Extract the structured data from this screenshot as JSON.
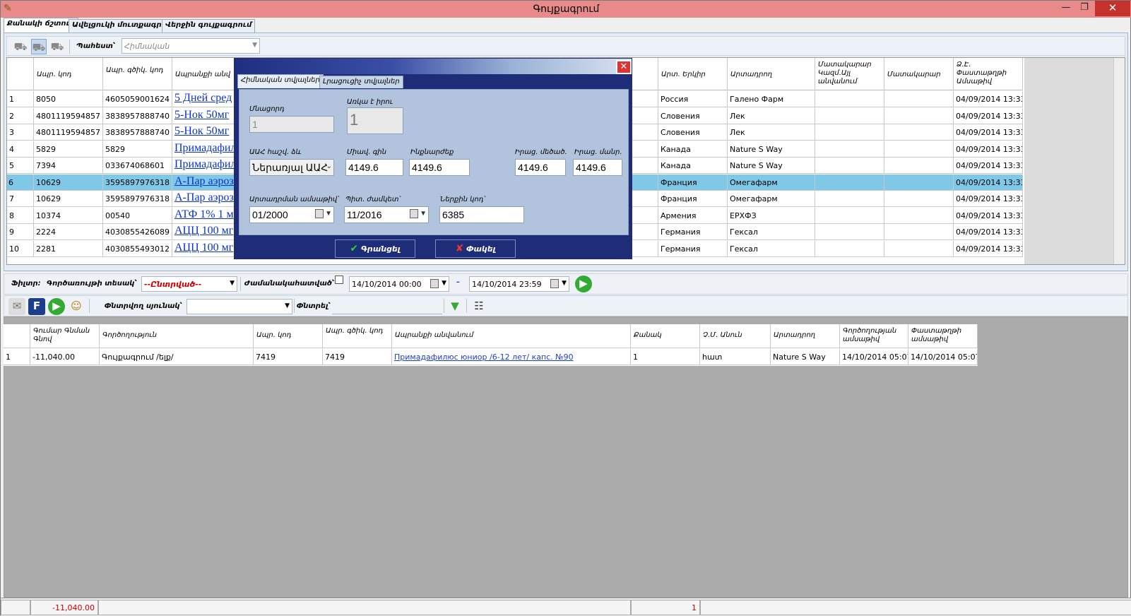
{
  "window": {
    "title": "Գույքագրում",
    "minimize": "—",
    "maximize": "❐",
    "close": "✕",
    "app_icon": "notebook-icon"
  },
  "tabs": [
    "Քանակի ճշտում",
    "Ավելցուկի մուտքագրում",
    "Վերջին գույքագրում"
  ],
  "toolbar1": {
    "warehouse_label": "Պահեստ՝",
    "warehouse_value": "Հիմնական"
  },
  "main_grid": {
    "headers": [
      "Ապր. կոդ",
      "Ապր. գծիկ. կոդ",
      "Ապրանքի անվ",
      "Արտ. Երկիր",
      "Արտադրող",
      "Մատակարար Կազմ.Այլ անվանում",
      "Մատակարար",
      "Ձ.Է. Փաստաթղթի Ամսաթիվ"
    ],
    "rows": [
      {
        "n": "1",
        "code": "8050",
        "barcode": "4605059001624",
        "name": "5 Дней сред",
        "country": "Россия",
        "maker": "Галено Фарм",
        "date": "04/09/2014 13:33"
      },
      {
        "n": "2",
        "code": "4801119594857",
        "barcode": "3838957888740",
        "name": "5-Нок 50мг",
        "country": "Словения",
        "maker": "Лек",
        "date": "04/09/2014 13:33"
      },
      {
        "n": "3",
        "code": "4801119594857",
        "barcode": "3838957888740",
        "name": "5-Нок 50мг",
        "country": "Словения",
        "maker": "Лек",
        "date": "04/09/2014 13:33"
      },
      {
        "n": "4",
        "code": "5829",
        "barcode": "5829",
        "name": "Примадафил",
        "country": "Канада",
        "maker": "Nature S Way",
        "date": "04/09/2014 13:33"
      },
      {
        "n": "5",
        "code": "7394",
        "barcode": "033674068601",
        "name": "Примадафил",
        "country": "Канада",
        "maker": "Nature S Way",
        "date": "04/09/2014 13:33"
      },
      {
        "n": "6",
        "code": "10629",
        "barcode": "3595897976318",
        "name": "А-Пар аэроз",
        "country": "Франция",
        "maker": "Омегафарм",
        "date": "04/09/2014 13:33"
      },
      {
        "n": "7",
        "code": "10629",
        "barcode": "3595897976318",
        "name": "А-Пар аэроз",
        "country": "Франция",
        "maker": "Омегафарм",
        "date": "04/09/2014 13:33"
      },
      {
        "n": "8",
        "code": "10374",
        "barcode": "00540",
        "name": "АТФ 1% 1 м",
        "country": "Армения",
        "maker": "ЕРХФЗ",
        "date": "04/09/2014 13:33"
      },
      {
        "n": "9",
        "code": "2224",
        "barcode": "4030855426089",
        "name": "АЦЦ 100 мг",
        "country": "Германия",
        "maker": "Гексал",
        "date": "04/09/2014 13:33"
      },
      {
        "n": "10",
        "code": "2281",
        "barcode": "4030855493012",
        "name": "АЦЦ 100 мг",
        "country": "Германия",
        "maker": "Гексал",
        "date": "04/09/2014 13:33"
      }
    ]
  },
  "dialog": {
    "tab_main": "Հիմնական տվյալներ",
    "tab_extra": "Լրացուցիչ տվյալներ",
    "remainder_label": "Մնացորդ",
    "remainder_value": "1",
    "actual_label": "Առկա է իրու",
    "actual_value": "1",
    "vat_label": "ԱԱՀ հաշվ. ձև",
    "vat_value": "Ներառյալ ԱԱՀ",
    "unit_price_label": "Միավ. գին",
    "unit_price_value": "4149.6",
    "cost_label": "Ինքնարժեք",
    "cost_value": "4149.6",
    "wholesale_label": "Իրաց. մեծած.",
    "wholesale_value": "4149.6",
    "retail_label": "Իրաց. մանր.",
    "retail_value": "4149.6",
    "prod_date_label": "Արտադրման ամսաթիվ՝",
    "prod_date_value": "01/2000",
    "expiry_label": "Պիտ. ժամկետ՝",
    "expiry_value": "11/2016",
    "internal_code_label": "Ներքին կոդ՝",
    "internal_code_value": "6385",
    "ok_label": "Գրանցել",
    "cancel_label": "Փակել"
  },
  "filter": {
    "label": "Ֆիլտր:",
    "op_type_label": "Գործառույթի տեսակ՝",
    "op_type_value": "--Ընտրված--",
    "period_label": "Ժամանակահատված՝",
    "date_from": "14/10/2014 00:00",
    "dash": "–",
    "date_to": "14/10/2014 23:59"
  },
  "toolbar2": {
    "search_col_label": "Փնտրվող սյունակ՝",
    "search_label": "Փնտրել՝"
  },
  "bottom_grid": {
    "headers": [
      "Գումար Գնման Գնով",
      "Գործողություն",
      "Ապր. կոդ",
      "Ապր. գծիկ. կոդ",
      "Ապրանքի անվանում",
      "Քանակ",
      "Չ.Մ. Անուն",
      "Արտադրող",
      "Գործողության ամսաթիվ",
      "Փաստաթղթի ամսաթիվ"
    ],
    "rows": [
      {
        "n": "1",
        "sum": "-11,040.00",
        "op": "Գույքագրում /ելք/",
        "code": "7419",
        "barcode": "7419",
        "name": "Примадафилюс юниор /6-12 лет/ капс. №90",
        "qty": "1",
        "unit": "հատ",
        "maker": "Nature S Way",
        "op_date": "14/10/2014 05:07",
        "doc_date": "14/10/2014 05:07"
      }
    ]
  },
  "status": {
    "total_sum": "-11,040.00",
    "total_qty": "1"
  },
  "colors": {
    "titlebar": "#e98a8a",
    "selected_row": "#80c8e8",
    "dialog_blue": "#1e2d78",
    "link": "#1a3fd9"
  }
}
